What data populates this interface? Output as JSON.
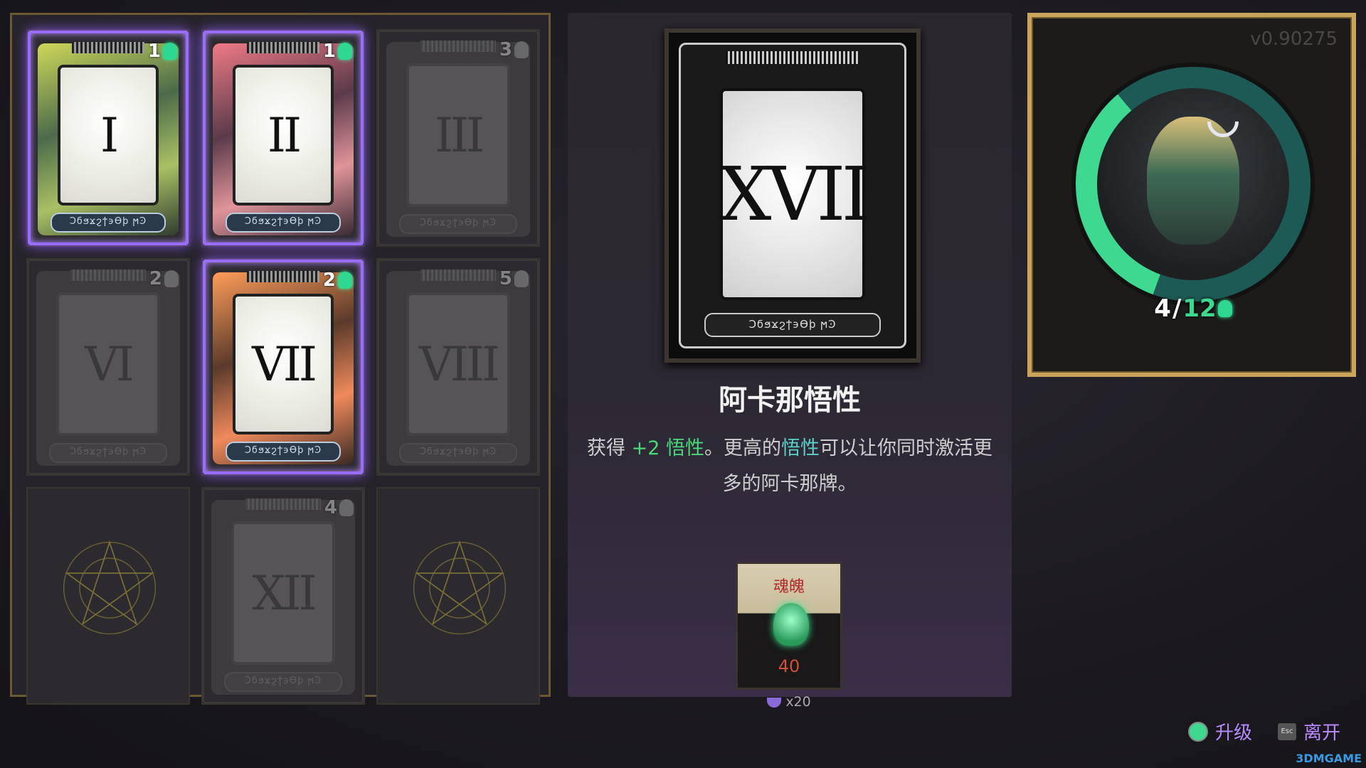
{
  "cards": [
    {
      "numeral": "I",
      "cost": "1",
      "active": true,
      "theme": "c1",
      "empty": false
    },
    {
      "numeral": "II",
      "cost": "1",
      "active": true,
      "theme": "c2",
      "empty": false
    },
    {
      "numeral": "III",
      "cost": "3",
      "active": false,
      "theme": "",
      "empty": false
    },
    {
      "numeral": "VI",
      "cost": "2",
      "active": false,
      "theme": "",
      "empty": false
    },
    {
      "numeral": "VII",
      "cost": "2",
      "active": true,
      "theme": "c7",
      "empty": false
    },
    {
      "numeral": "VIII",
      "cost": "5",
      "active": false,
      "theme": "",
      "empty": false
    },
    {
      "numeral": "",
      "cost": "",
      "active": false,
      "theme": "",
      "empty": true
    },
    {
      "numeral": "XII",
      "cost": "4",
      "active": false,
      "theme": "",
      "empty": false
    },
    {
      "numeral": "",
      "cost": "",
      "active": false,
      "theme": "",
      "empty": true
    }
  ],
  "card_script": "Ͻϭϧϫϩϯ϶ϴϸ ϻϿ",
  "detail": {
    "numeral": "XVII",
    "title": "阿卡那悟性",
    "desc_prefix": "获得 ",
    "desc_bonus": "+2 悟性",
    "desc_mid": "。更高的",
    "desc_term": "悟性",
    "desc_suffix": "可以让你同时激活更多的阿卡那牌。"
  },
  "price": {
    "label": "魂魄",
    "value": "40",
    "owned": "x20",
    "icon": "psyche-icon"
  },
  "grasp": {
    "current": "4",
    "separator": "/",
    "max": "12",
    "icon": "grasp-icon",
    "ratio": 0.333
  },
  "version": "v0.90275",
  "prompts": {
    "upgrade": "升级",
    "exit": "离开",
    "esc_key": "Esc"
  },
  "watermark": "3DMGAME",
  "colors": {
    "accent_green": "#3ed890",
    "accent_purple": "#9a6cff",
    "gold_frame": "#c9a45a",
    "price_red": "#d0503a"
  }
}
